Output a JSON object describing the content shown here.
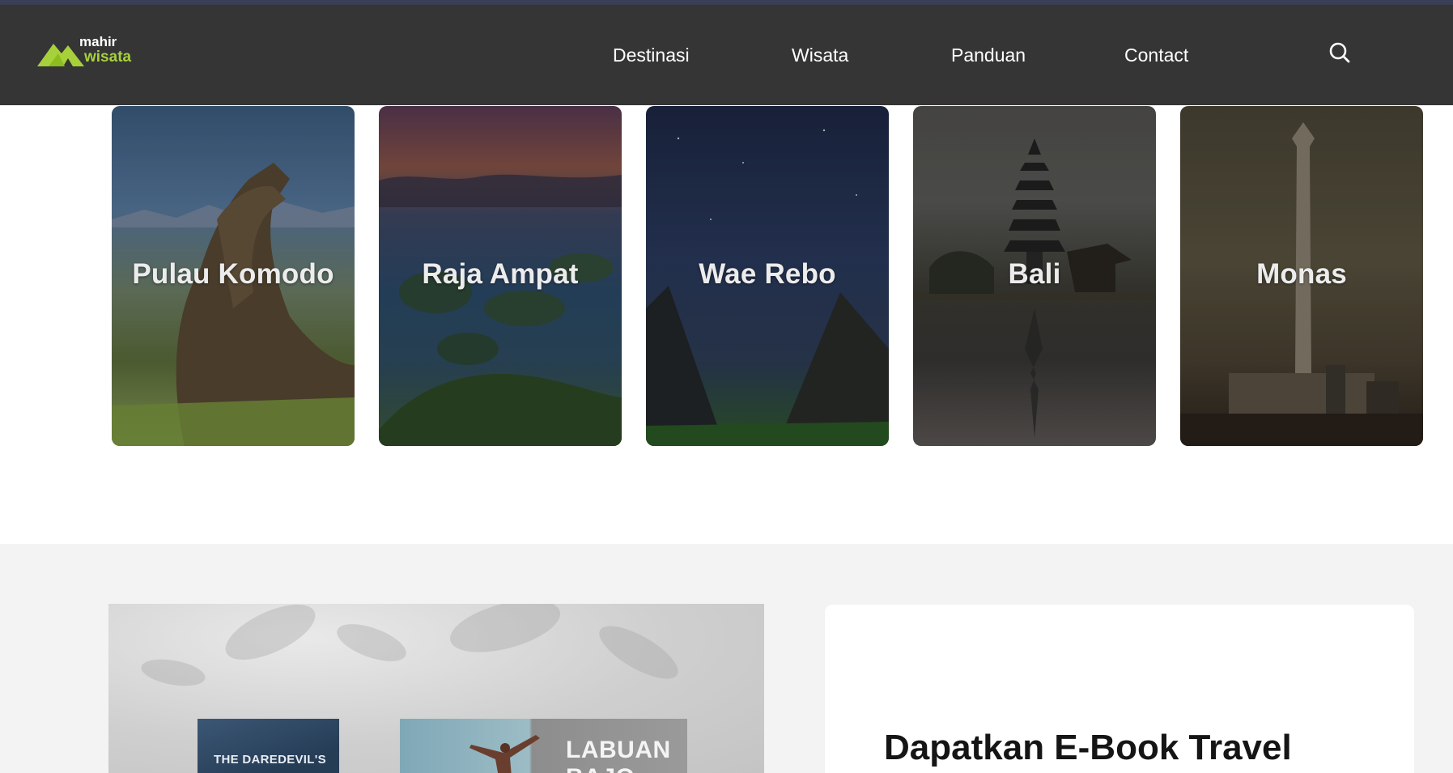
{
  "brand": {
    "name_top": "mahir",
    "name_bottom": "wisata",
    "accent_color": "#a6d13a",
    "icon": "mountain-logo-icon"
  },
  "nav": {
    "items": [
      {
        "label": "Destinasi"
      },
      {
        "label": "Wisata"
      },
      {
        "label": "Panduan"
      },
      {
        "label": "Contact"
      }
    ],
    "search_icon": "search-icon"
  },
  "destinations": [
    {
      "title": "Pulau Komodo"
    },
    {
      "title": "Raja Ampat"
    },
    {
      "title": "Wae Rebo"
    },
    {
      "title": "Bali"
    },
    {
      "title": "Monas"
    }
  ],
  "ebook": {
    "heading": "Dapatkan E-Book Travel",
    "book1_title": "THE DAREDEVIL'S",
    "book2_title": "LABUAN BAJO"
  },
  "colors": {
    "navbar_bg": "#262626",
    "section_bg": "#f3f3f3"
  }
}
